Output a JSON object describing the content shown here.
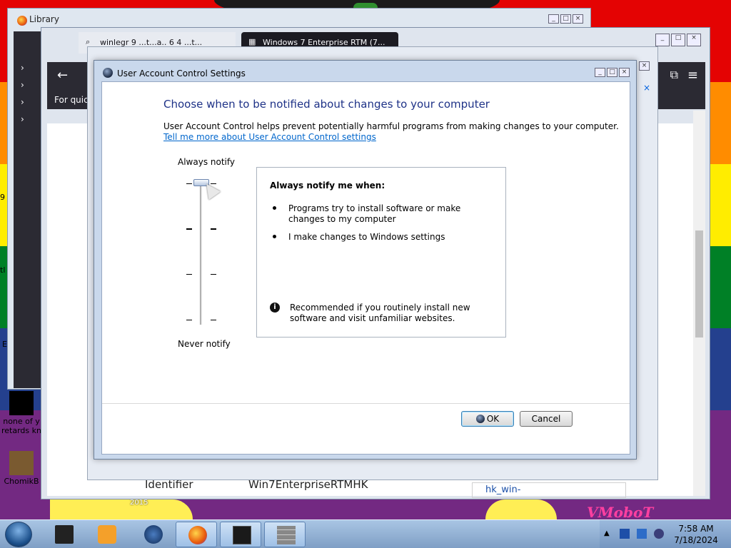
{
  "desktop": {
    "watermark": "VMoboT",
    "year_label": "2015",
    "icon_labels": [
      "none of y",
      "retards kn",
      "ChomikB"
    ],
    "edge_texts": [
      "9",
      "tl",
      "E"
    ]
  },
  "library_window": {
    "title": "Library",
    "rows": [
      "›",
      "›",
      "›",
      "›"
    ]
  },
  "browser_window": {
    "tab1_label": "winlegr 9 ...t...a.. 6 4 ...t...",
    "tab2_label": "Windows 7 Enterprise RTM (7...",
    "quick_text": "For quick",
    "identifier_label": "Identifier",
    "identifier_value": "Win7EnterpriseRTMHK",
    "link_value": "hk_win-"
  },
  "uac": {
    "title": "User Account Control Settings",
    "heading": "Choose when to be notified about changes to your computer",
    "description": "User Account Control helps prevent potentially harmful programs from making changes to your computer.",
    "learn_more_link": "Tell me more about User Account Control settings",
    "slider_top_label": "Always notify",
    "slider_bottom_label": "Never notify",
    "slider_level": 4,
    "slider_levels": 4,
    "info_title": "Always notify me when:",
    "info_bullets": [
      "Programs try to install software or make changes to my computer",
      "I make changes to Windows settings"
    ],
    "info_icon_glyph": "i",
    "recommendation": "Recommended if you routinely install new software and visit unfamiliar websites.",
    "ok_label": "OK",
    "cancel_label": "Cancel"
  },
  "taskbar": {
    "items": [
      "terminal-icon",
      "media-player-icon",
      "globe-icon",
      "firefox-icon",
      "video-window-icon",
      "brick-wall-icon"
    ],
    "clock_time": "7:58 AM",
    "clock_date": "7/18/2024"
  },
  "colors": {
    "uac_heading": "#1e3287",
    "link": "#0066cc",
    "taskbar": "#9bb9dc"
  }
}
